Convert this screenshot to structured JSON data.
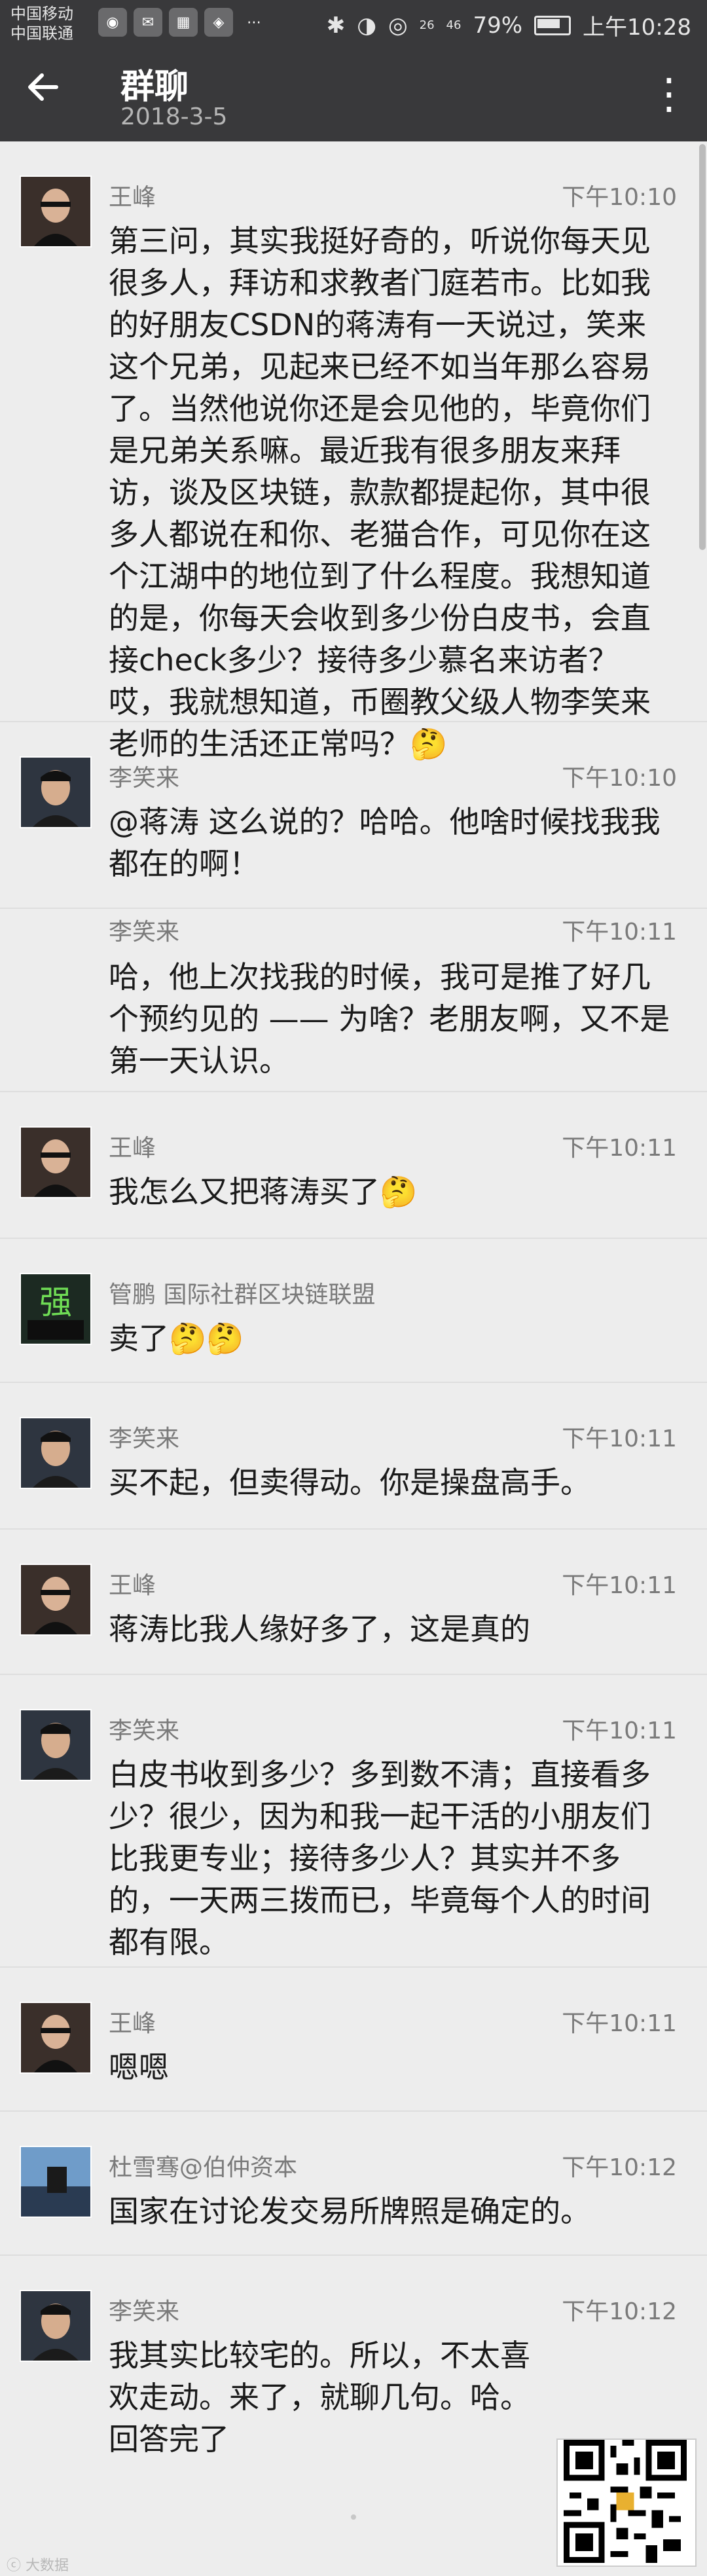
{
  "status_bar": {
    "carrier_1": "中国移动",
    "carrier_2": "中国联通",
    "signal_1": "26",
    "signal_2": "46",
    "battery": "79%",
    "time": "上午10:28"
  },
  "header": {
    "title": "群聊",
    "subtitle": "2018-3-5"
  },
  "messages": [
    {
      "name": "王峰",
      "time": "下午10:10",
      "text": "第三问，其实我挺好奇的，听说你每天见很多人，拜访和求教者门庭若市。比如我的好朋友CSDN的蒋涛有一天说过，笑来这个兄弟，见起来已经不如当年那么容易了。当然他说你还是会见他的，毕竟你们是兄弟关系嘛。最近我有很多朋友来拜访，谈及区块链，款款都提起你，其中很多人都说在和你、老猫合作，可见你在这个江湖中的地位到了什么程度。我想知道的是，你每天会收到多少份白皮书，会直接check多少？接待多少慕名来访者？哎，我就想知道，币圈教父级人物李笑来老师的生活还正常吗？🤔"
    },
    {
      "name": "李笑来",
      "time": "下午10:10",
      "text": "@蒋涛 这么说的？哈哈。他啥时候找我我都在的啊！"
    },
    {
      "name": "李笑来",
      "time": "下午10:11",
      "text": "哈，他上次找我的时候，我可是推了好几个预约见的 —— 为啥？老朋友啊，又不是第一天认识。"
    },
    {
      "name": "王峰",
      "time": "下午10:11",
      "text": "我怎么又把蒋涛买了🤔"
    },
    {
      "name": "管鹏  国际社群区块链联盟",
      "time": "",
      "text": "卖了🤔🤔"
    },
    {
      "name": "李笑来",
      "time": "下午10:11",
      "text": "买不起，但卖得动。你是操盘高手。"
    },
    {
      "name": "王峰",
      "time": "下午10:11",
      "text": "蒋涛比我人缘好多了，这是真的"
    },
    {
      "name": "李笑来",
      "time": "下午10:11",
      "text": "白皮书收到多少？多到数不清；直接看多少？很少，因为和我一起干活的小朋友们比我更专业；接待多少人？其实并不多的，一天两三拨而已，毕竟每个人的时间都有限。"
    },
    {
      "name": "王峰",
      "time": "下午10:11",
      "text": "嗯嗯"
    },
    {
      "name": "杜雪骞@伯仲资本",
      "time": "下午10:12",
      "text": "国家在讨论发交易所牌照是确定的。"
    },
    {
      "name": "李笑来",
      "time": "下午10:12",
      "text": "我其实比较宅的。所以，不太喜欢走动。来了，就聊几句。哈。回答完了"
    }
  ],
  "footer": {
    "watermark": "ⓒ 大数据"
  }
}
